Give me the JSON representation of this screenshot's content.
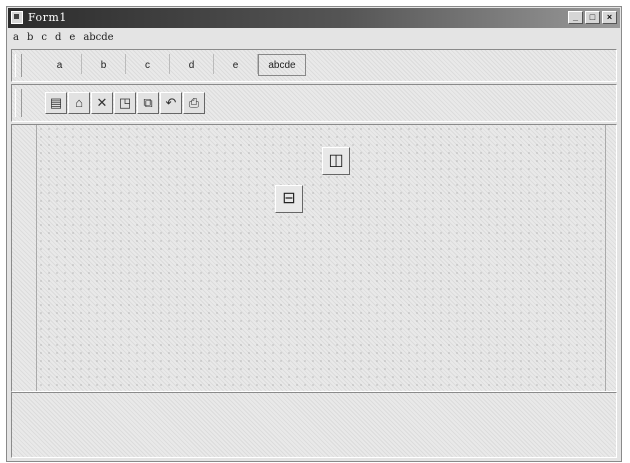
{
  "window": {
    "title": "Form1"
  },
  "title_buttons": [
    {
      "name": "minimize-button",
      "glyph": "_"
    },
    {
      "name": "maximize-button",
      "glyph": "□"
    },
    {
      "name": "close-button",
      "glyph": "×"
    }
  ],
  "menu": {
    "items": [
      "a",
      "b",
      "c",
      "d",
      "e",
      "abcde"
    ]
  },
  "tabs": {
    "items": [
      "a",
      "b",
      "c",
      "d",
      "e",
      "abcde"
    ]
  },
  "toolbar": {
    "tools": [
      {
        "icon": "new-form-icon",
        "glyph": "▤"
      },
      {
        "icon": "open-folder-icon",
        "glyph": "⌂"
      },
      {
        "icon": "delete-icon",
        "glyph": "✕"
      },
      {
        "icon": "print-preview-icon",
        "glyph": "◳"
      },
      {
        "icon": "copy-icon",
        "glyph": "⧉"
      },
      {
        "icon": "undo-icon",
        "glyph": "↶"
      },
      {
        "icon": "print-icon",
        "glyph": "⎙"
      }
    ]
  },
  "components": [
    {
      "icon": "menu-component-icon",
      "glyph": "◫"
    },
    {
      "icon": "popup-menu-component-icon",
      "glyph": "⊟"
    }
  ]
}
